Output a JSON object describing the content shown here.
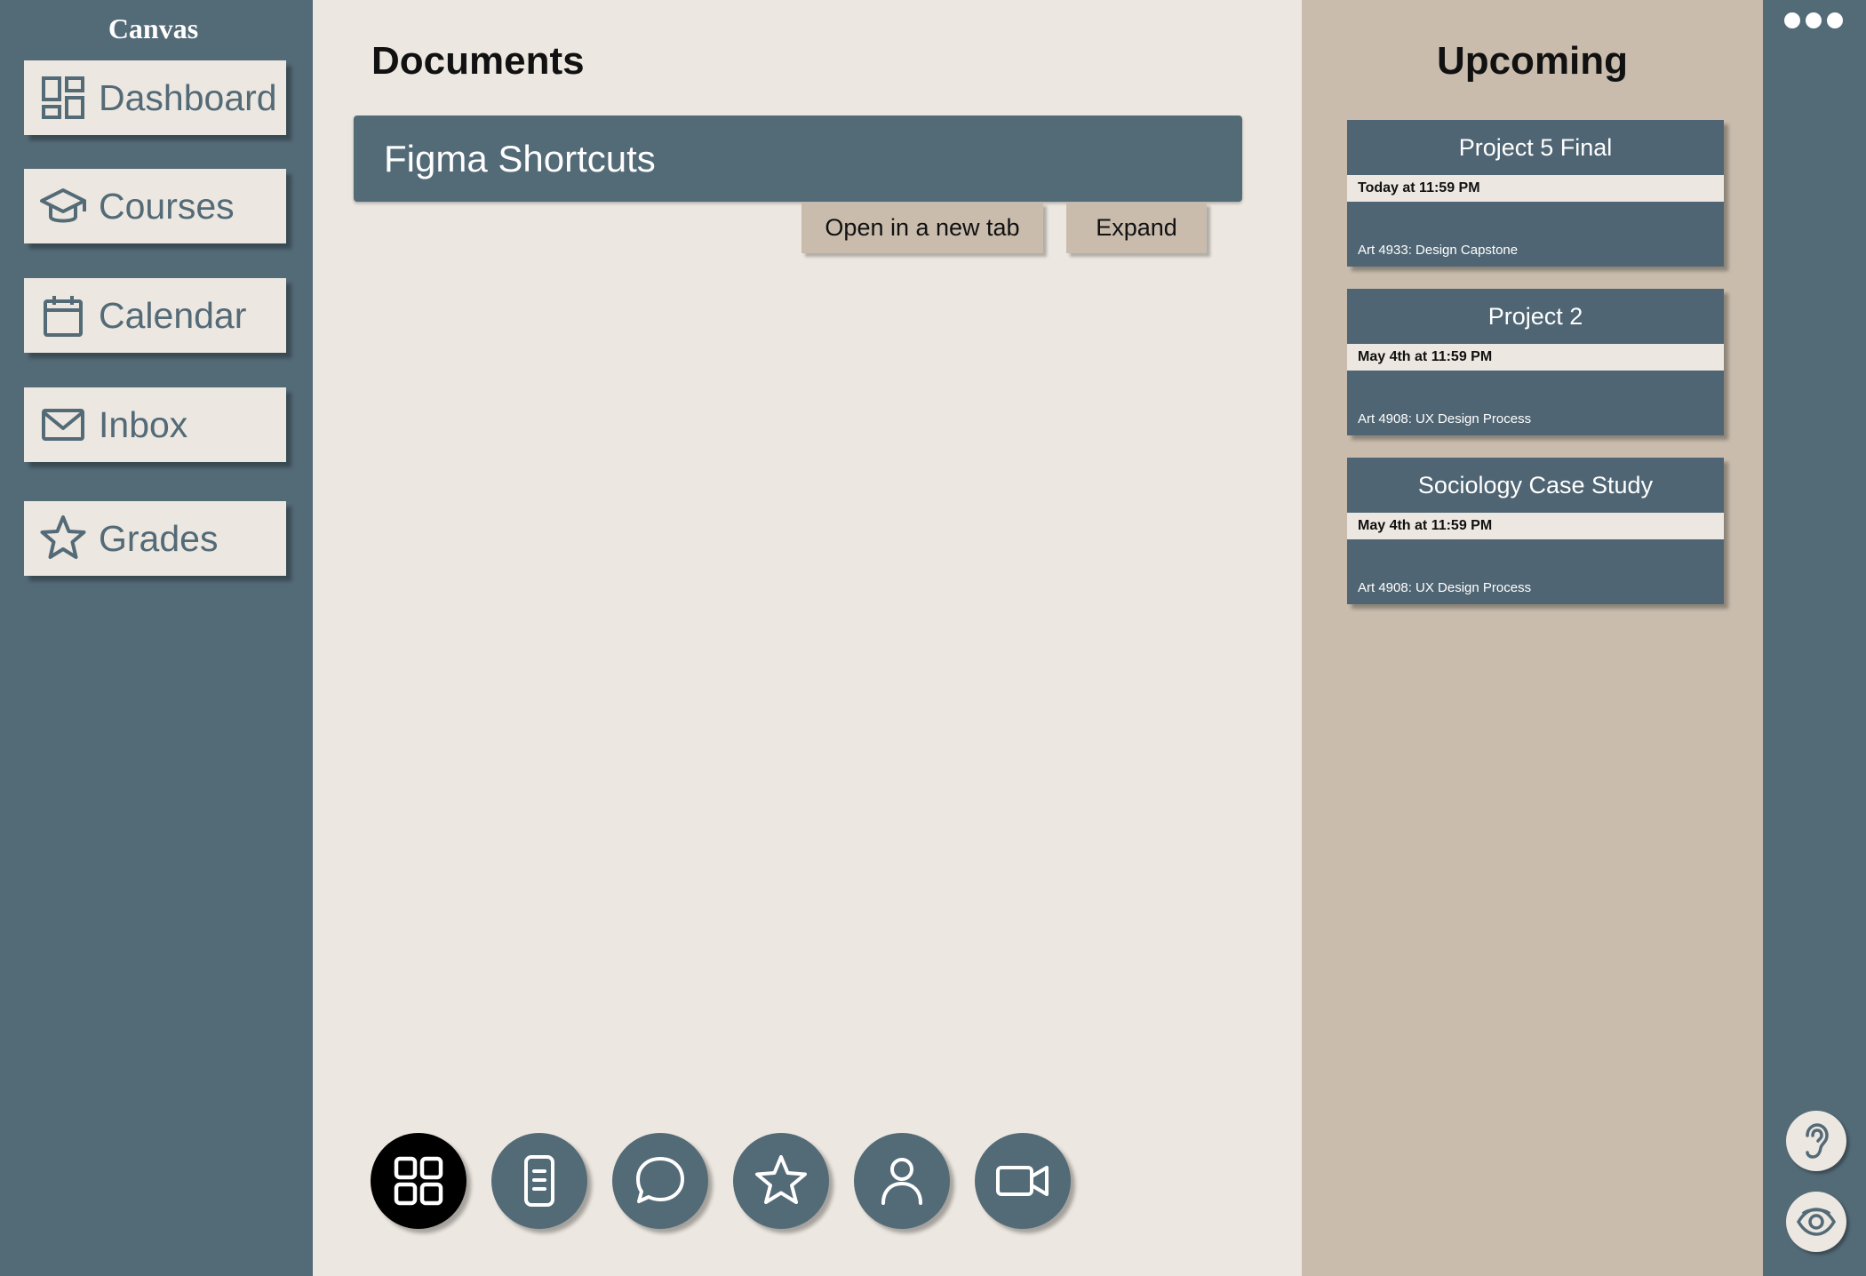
{
  "sidebar": {
    "brand": "Canvas",
    "items": [
      {
        "label": "Dashboard",
        "icon": "dashboard-icon"
      },
      {
        "label": "Courses",
        "icon": "graduation-cap-icon"
      },
      {
        "label": "Calendar",
        "icon": "calendar-icon"
      },
      {
        "label": "Inbox",
        "icon": "mail-icon"
      },
      {
        "label": "Grades",
        "icon": "star-icon"
      }
    ]
  },
  "main": {
    "title": "Documents",
    "document": {
      "name": "Figma Shortcuts",
      "open_label": "Open in a new tab",
      "expand_label": "Expand"
    },
    "bottom_nav": [
      {
        "icon": "grid-icon",
        "active": true
      },
      {
        "icon": "document-icon",
        "active": false
      },
      {
        "icon": "chat-icon",
        "active": false
      },
      {
        "icon": "star-icon",
        "active": false
      },
      {
        "icon": "person-icon",
        "active": false
      },
      {
        "icon": "video-camera-icon",
        "active": false
      }
    ]
  },
  "upcoming": {
    "title": "Upcoming",
    "cards": [
      {
        "title": "Project 5 Final",
        "due": "Today at 11:59 PM",
        "course": "Art 4933: Design Capstone"
      },
      {
        "title": "Project 2",
        "due": "May 4th at 11:59 PM",
        "course": "Art 4908: UX Design Process"
      },
      {
        "title": "Sociology Case Study",
        "due": "May 4th at 11:59 PM",
        "course": "Art 4908: UX Design Process"
      }
    ]
  },
  "rightbar": {
    "menu_icon": "more-dots-icon",
    "accessibility": [
      "ear-icon",
      "eye-icon"
    ]
  },
  "colors": {
    "slate": "#536A77",
    "card_slate": "#4F6573",
    "cream": "#ECE7E0",
    "tan": "#C9BCAD",
    "active": "#000000"
  }
}
